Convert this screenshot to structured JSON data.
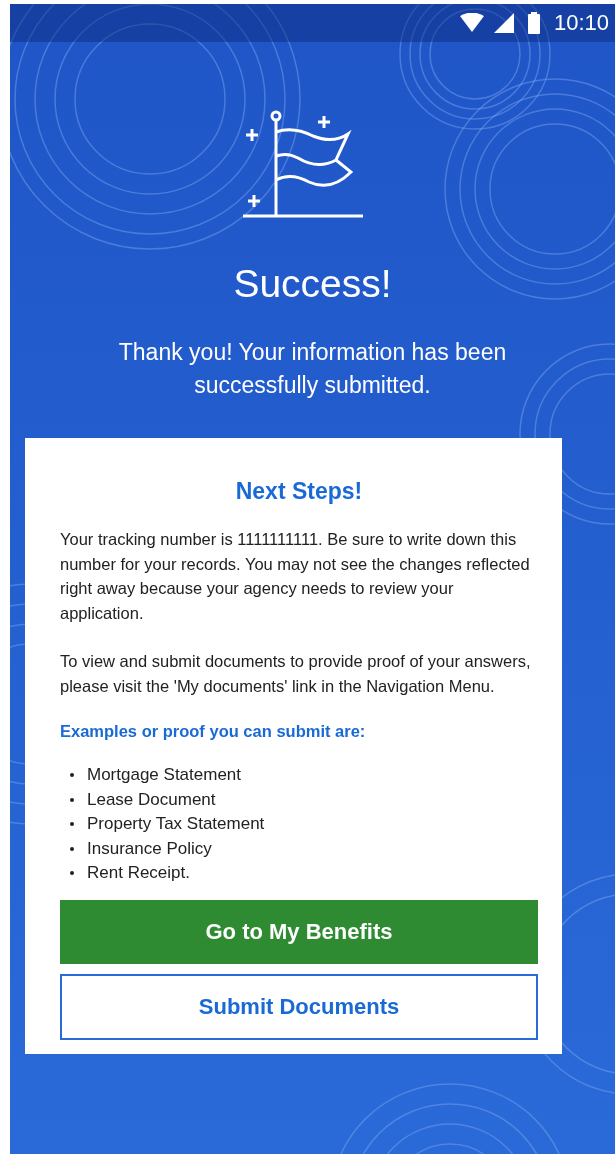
{
  "status_bar": {
    "time": "10:10"
  },
  "header": {
    "title": "Success!",
    "message": "Thank you! Your information has been successfully submitted."
  },
  "card": {
    "title": "Next Steps!",
    "paragraphs": [
      "Your tracking number is 1111111111. Be sure to write down this number for your records. You may not see the changes reflected right away because your agency needs to review your application.",
      "To view and submit documents to provide proof of your answers, please visit the 'My documents' link in the Navigation Menu."
    ],
    "examples_heading": "Examples or proof you can submit are:",
    "examples": [
      "Mortgage Statement",
      "Lease Document",
      "Property Tax Statement",
      "Insurance Policy",
      "Rent Receipt."
    ],
    "buttons": [
      {
        "label": "Go to My Benefits",
        "kind": "primary"
      },
      {
        "label": "Submit Documents",
        "kind": "outline"
      }
    ]
  }
}
